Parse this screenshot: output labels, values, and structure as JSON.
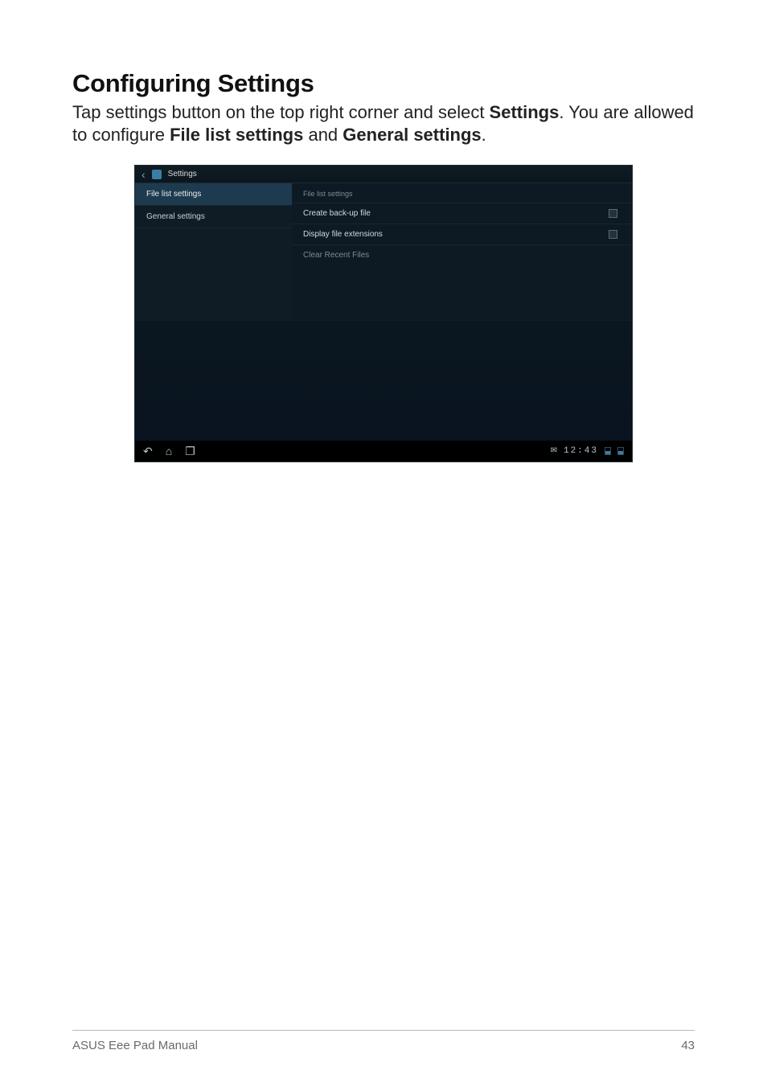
{
  "doc": {
    "heading": "Configuring Settings",
    "intro_pre": "Tap settings button on the top right corner and select ",
    "intro_b1": "Settings",
    "intro_mid": ". You are allowed to configure ",
    "intro_b2": "File list settings",
    "intro_and": " and ",
    "intro_b3": "General settings",
    "intro_end": "."
  },
  "screenshot": {
    "titlebar_label": "Settings",
    "sidebar": {
      "item0": "File list settings",
      "item1": "General settings"
    },
    "panel": {
      "title": "File list settings",
      "row0": "Create back-up file",
      "row1": "Display file extensions",
      "row2": "Clear Recent Files"
    },
    "clock": "12:43"
  },
  "footer": {
    "left": "ASUS Eee Pad Manual",
    "right": "43"
  }
}
